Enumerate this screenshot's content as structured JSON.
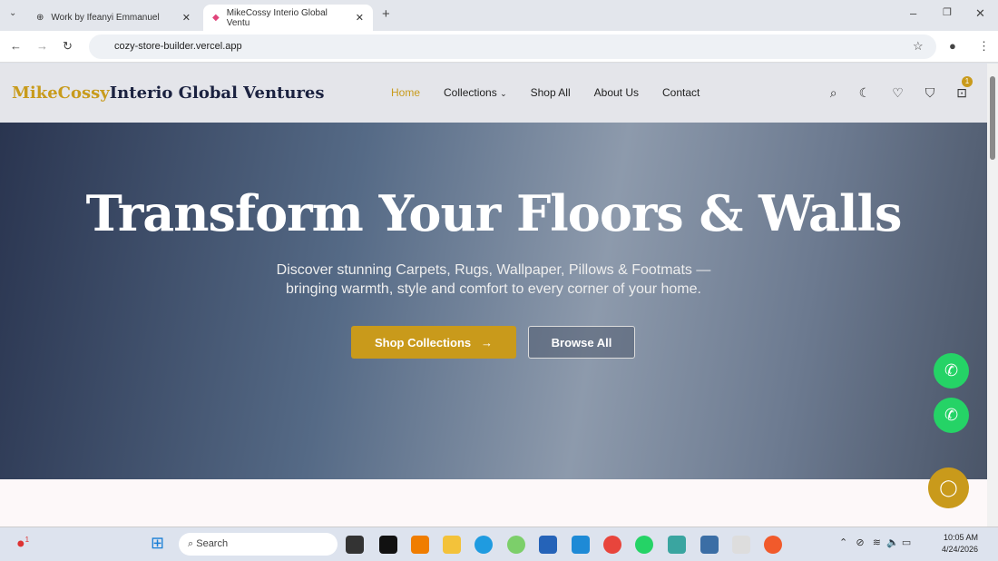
{
  "browser": {
    "tabs": [
      {
        "title": "Work by Ifeanyi Emmanuel"
      },
      {
        "title": "MikeCossy Interio Global Ventu"
      }
    ],
    "url": "cozy-store-builder.vercel.app"
  },
  "header": {
    "logo_accent": "MikeCossy",
    "logo_rest": "Interio Global Ventures",
    "nav": [
      "Home",
      "Collections",
      "Shop All",
      "About Us",
      "Contact"
    ],
    "cart_count": "1"
  },
  "hero": {
    "title": "Transform Your Floors & Walls",
    "subtitle_line1": "Discover stunning Carpets, Rugs, Wallpaper, Pillows & Footmats —",
    "subtitle_line2": "bringing warmth, style and comfort to every corner of your home.",
    "primary_button": "Shop Collections",
    "secondary_button": "Browse All"
  },
  "colors": {
    "accent": "#c99a1b",
    "whatsapp": "#25d366"
  },
  "taskbar": {
    "search_placeholder": "Search",
    "time": "10:05 AM",
    "date": "4/24/2026",
    "notification_count": "1"
  }
}
